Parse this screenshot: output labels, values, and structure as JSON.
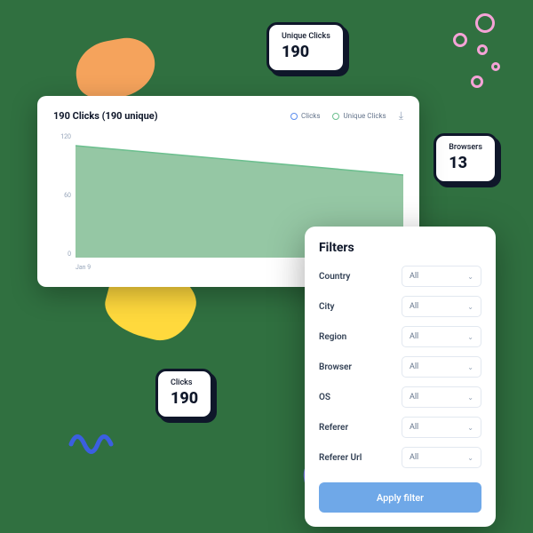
{
  "stats": {
    "unique_clicks": {
      "label": "Unique Clicks",
      "value": "190"
    },
    "browsers": {
      "label": "Browsers",
      "value": "13"
    },
    "clicks": {
      "label": "Clicks",
      "value": "190"
    }
  },
  "chart": {
    "title": "190 Clicks (190 unique)",
    "legend_clicks": "Clicks",
    "legend_unique": "Unique Clicks",
    "y0": "0",
    "y60": "60",
    "y120": "120",
    "x_label": "Jan 9"
  },
  "chart_data": {
    "type": "area",
    "title": "190 Clicks (190 unique)",
    "xlabel": "",
    "ylabel": "",
    "ylim": [
      0,
      120
    ],
    "x": [
      "Jan 9"
    ],
    "series": [
      {
        "name": "Clicks",
        "values": [
          108,
          80
        ]
      },
      {
        "name": "Unique Clicks",
        "values": [
          108,
          80
        ]
      }
    ]
  },
  "filters": {
    "title": "Filters",
    "rows": [
      {
        "label": "Country",
        "value": "All"
      },
      {
        "label": "City",
        "value": "All"
      },
      {
        "label": "Region",
        "value": "All"
      },
      {
        "label": "Browser",
        "value": "All"
      },
      {
        "label": "OS",
        "value": "All"
      },
      {
        "label": "Referer",
        "value": "All"
      },
      {
        "label": "Referer Url",
        "value": "All"
      }
    ],
    "apply_label": "Apply filter"
  },
  "colors": {
    "accent_blue": "#6FA8E8",
    "chart_fill": "#95C7A4"
  }
}
